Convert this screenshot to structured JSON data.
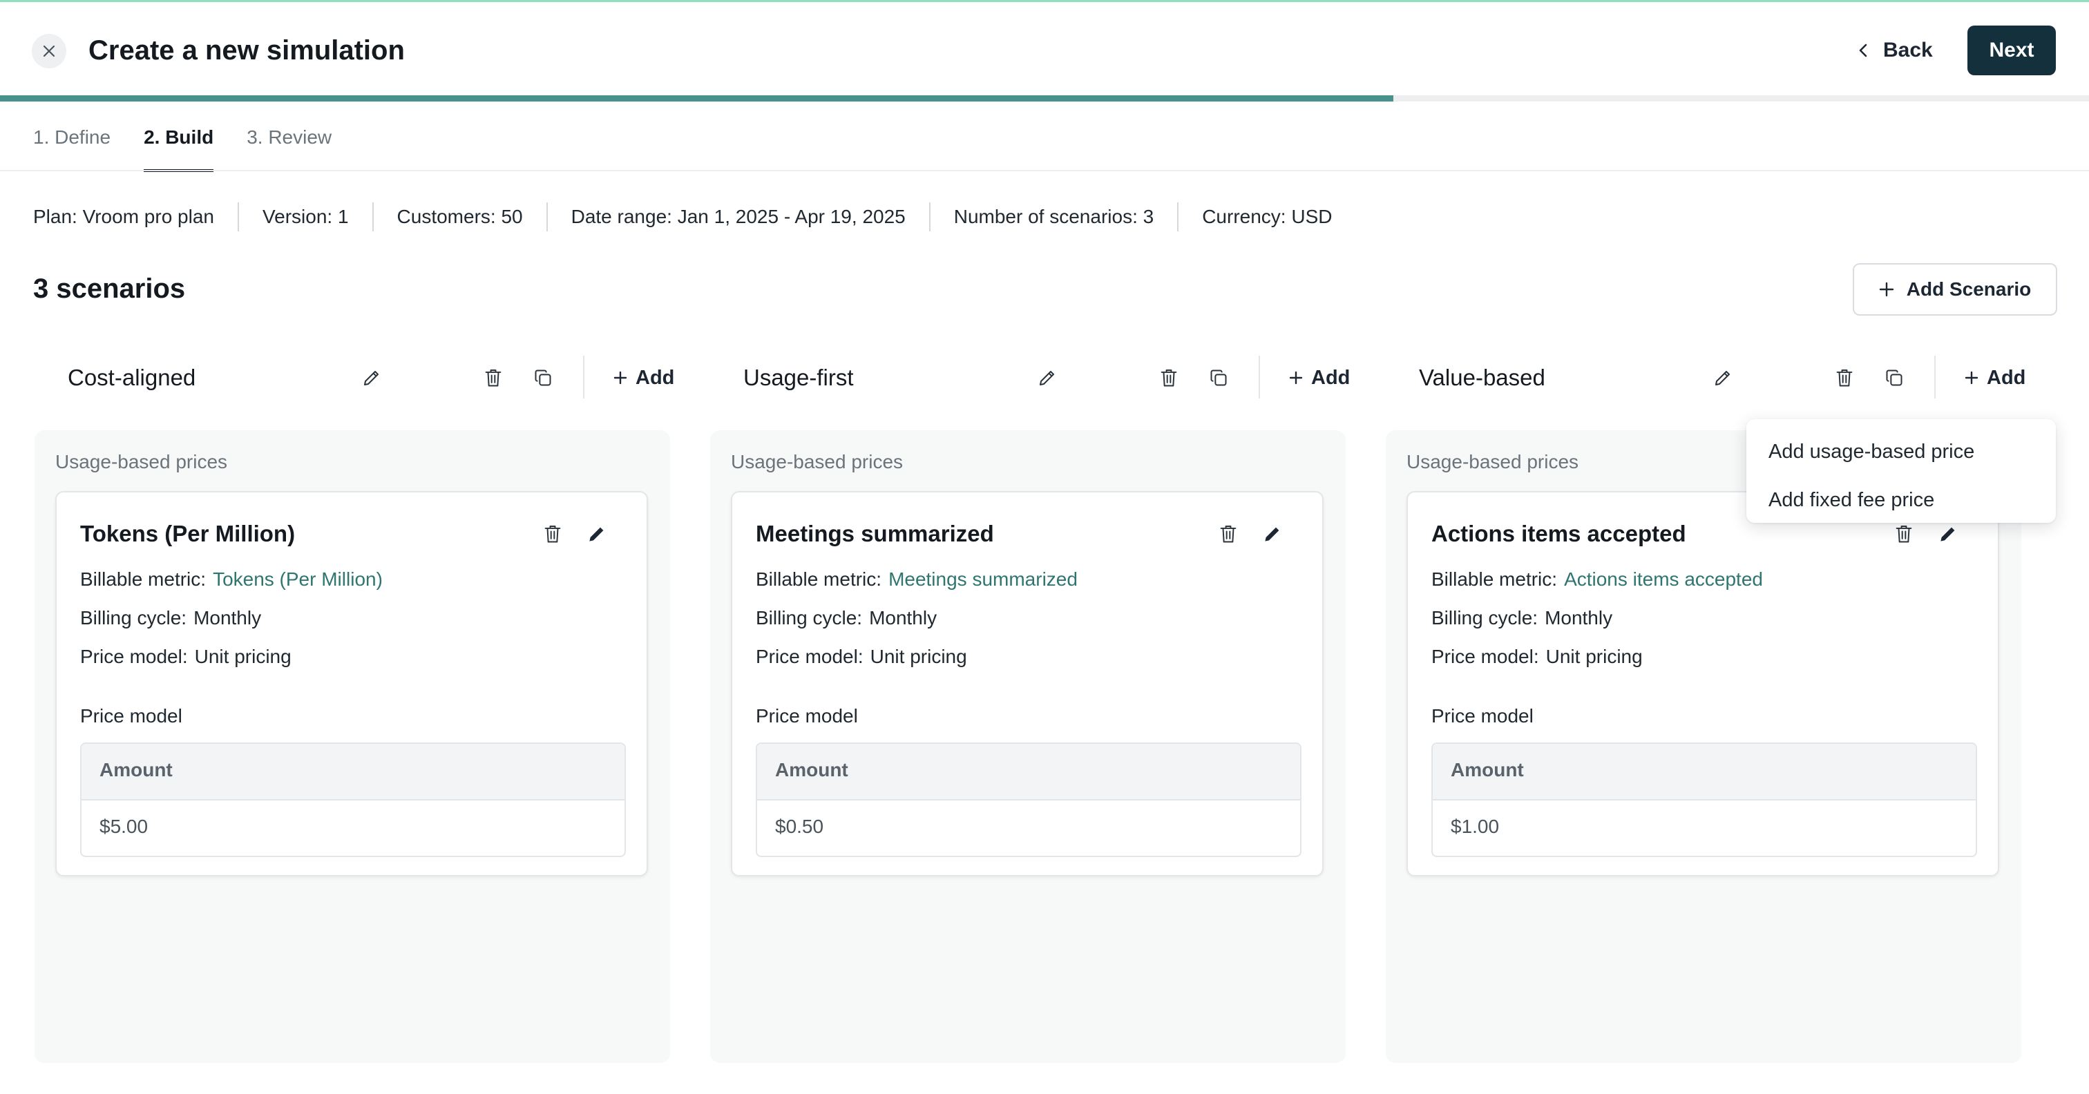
{
  "header": {
    "title": "Create a new simulation",
    "back_label": "Back",
    "next_label": "Next",
    "progress_fraction": 0.667
  },
  "tabs": [
    {
      "label": "1. Define",
      "active": false
    },
    {
      "label": "2. Build",
      "active": true
    },
    {
      "label": "3. Review",
      "active": false
    }
  ],
  "meta": [
    "Plan: Vroom pro plan",
    "Version: 1",
    "Customers: 50",
    "Date range: Jan 1, 2025 - Apr 19, 2025",
    "Number of scenarios: 3",
    "Currency: USD"
  ],
  "scenarios_heading": "3 scenarios",
  "add_scenario_label": "Add Scenario",
  "common": {
    "add_label": "Add",
    "section_label": "Usage-based prices",
    "billable_metric_label": "Billable metric:",
    "billing_cycle_label": "Billing cycle:",
    "price_model_row_label": "Price model:",
    "price_model_heading": "Price model",
    "amount_header": "Amount"
  },
  "scenarios": [
    {
      "name": "Cost-aligned",
      "price": {
        "title": "Tokens (Per Million)",
        "billable_metric": "Tokens (Per Million)",
        "billing_cycle": "Monthly",
        "price_model": "Unit pricing",
        "amount": "$5.00"
      }
    },
    {
      "name": "Usage-first",
      "price": {
        "title": "Meetings summarized",
        "billable_metric": "Meetings summarized",
        "billing_cycle": "Monthly",
        "price_model": "Unit pricing",
        "amount": "$0.50"
      }
    },
    {
      "name": "Value-based",
      "price": {
        "title": "Actions items accepted",
        "billable_metric": "Actions items accepted",
        "billing_cycle": "Monthly",
        "price_model": "Unit pricing",
        "amount": "$1.00"
      }
    }
  ],
  "dropdown": {
    "items": [
      "Add usage-based price",
      "Add fixed fee price"
    ]
  },
  "colors": {
    "accent": "#47928c",
    "primary_button": "#15303d",
    "link": "#2f7670",
    "top_border": "#8fe0bf"
  },
  "icons": {
    "close": "close-icon",
    "back": "chevron-left-icon",
    "plus": "plus-icon",
    "edit": "pencil-icon",
    "delete": "trash-icon",
    "duplicate": "copy-icon"
  }
}
